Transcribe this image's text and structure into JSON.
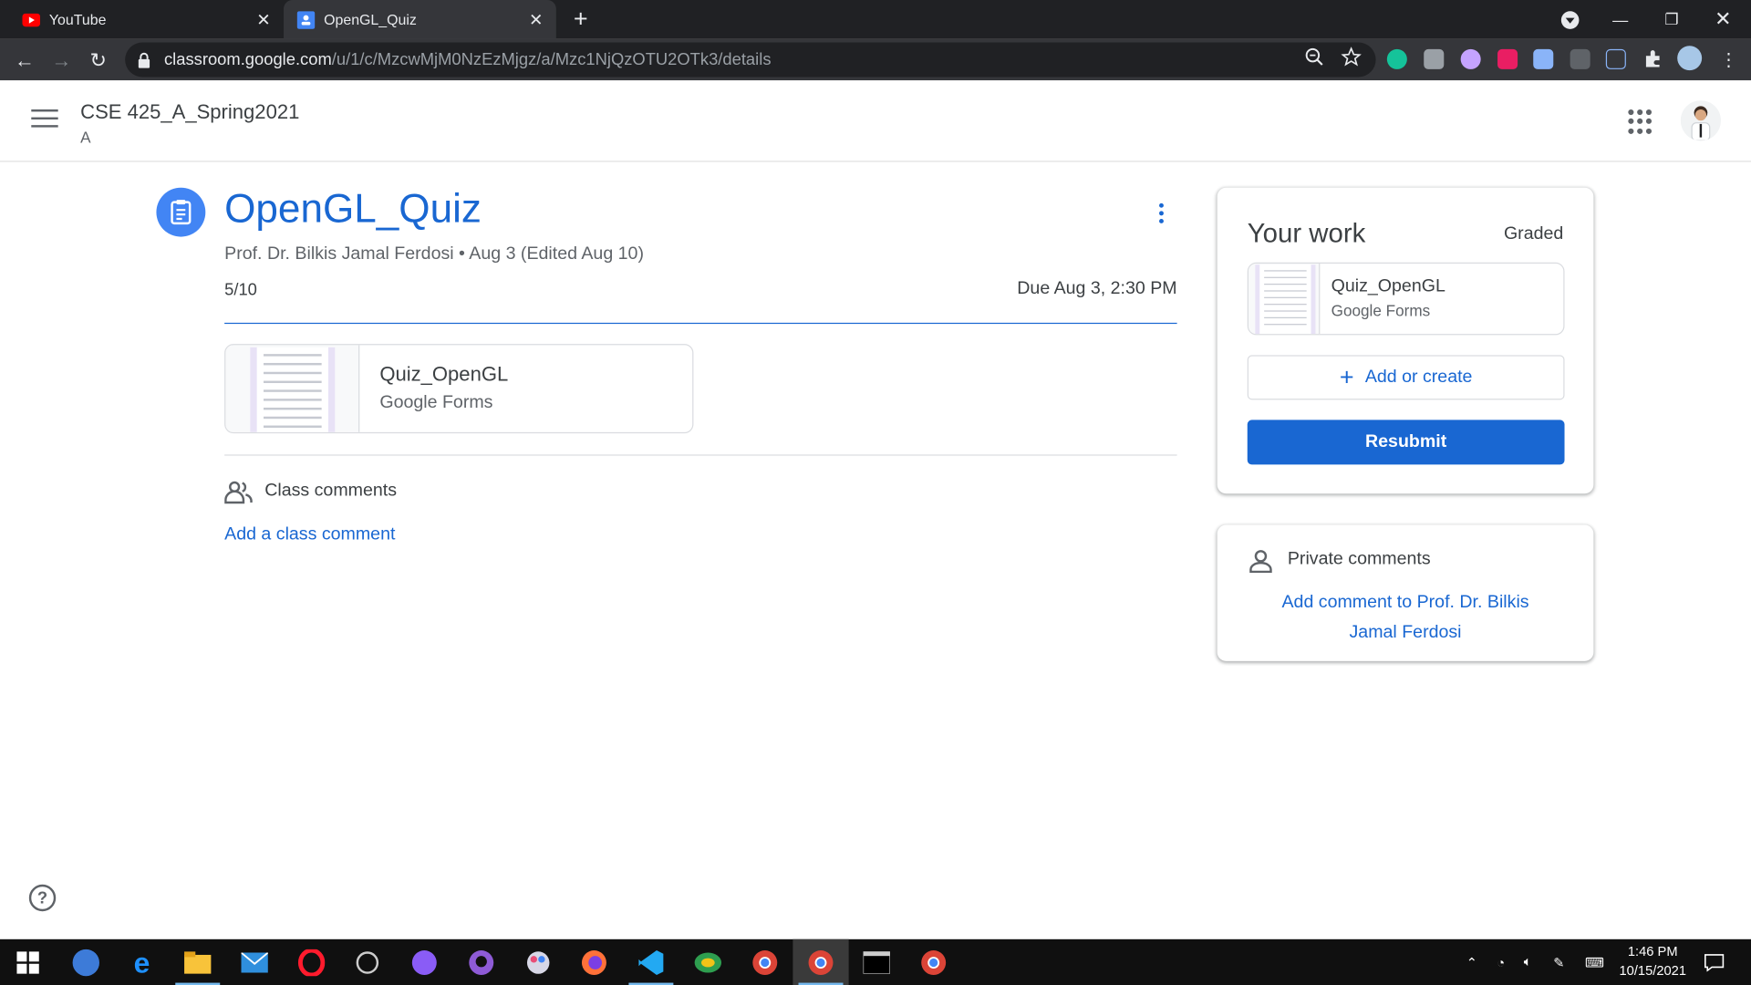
{
  "browser": {
    "tabs": [
      {
        "title": "YouTube",
        "active": false,
        "favicon": "youtube-icon"
      },
      {
        "title": "OpenGL_Quiz",
        "active": true,
        "favicon": "classroom-icon"
      }
    ],
    "url_host": "classroom.google.com",
    "url_path": "/u/1/c/MzcwMjM0NzEzMjgz/a/Mzc1NjQzOTU2OTk3/details"
  },
  "header": {
    "class_name": "CSE 425_A_Spring2021",
    "section": "A"
  },
  "assignment": {
    "title": "OpenGL_Quiz",
    "meta": "Prof. Dr. Bilkis Jamal Ferdosi • Aug 3 (Edited Aug 10)",
    "points": "5/10",
    "due": "Due Aug 3, 2:30 PM",
    "attachment": {
      "name": "Quiz_OpenGL",
      "type": "Google Forms"
    },
    "class_comments_label": "Class comments",
    "add_class_comment": "Add a class comment"
  },
  "your_work": {
    "title": "Your work",
    "status": "Graded",
    "attachment": {
      "name": "Quiz_OpenGL",
      "type": "Google Forms"
    },
    "add_or_create": "Add or create",
    "resubmit": "Resubmit"
  },
  "private_comments": {
    "label": "Private comments",
    "add_link": "Add comment to Prof. Dr. Bilkis Jamal Ferdosi"
  },
  "taskbar": {
    "time": "1:46 PM",
    "date": "10/15/2021"
  },
  "colors": {
    "accent": "#1967d2",
    "chrome_dark": "#202124",
    "chrome_toolbar": "#35363a"
  }
}
